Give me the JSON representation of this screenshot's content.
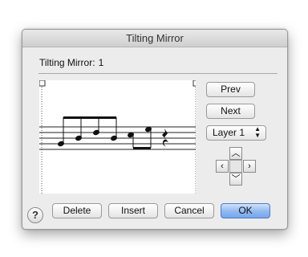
{
  "dialog": {
    "title": "Tilting Mirror",
    "label": "Tilting Mirror:",
    "mirror_number": "1"
  },
  "buttons": {
    "prev": "Prev",
    "next": "Next",
    "delete": "Delete",
    "insert": "Insert",
    "cancel": "Cancel",
    "ok": "OK",
    "help": "?"
  },
  "layer_popup": {
    "selected": "Layer 1"
  },
  "nudge": {
    "up": "up-arrow-icon",
    "down": "down-arrow-icon",
    "left": "left-arrow-icon",
    "right": "right-arrow-icon"
  },
  "colors": {
    "ok_button": "#77a6ec",
    "dialog_bg": "#ececec"
  }
}
